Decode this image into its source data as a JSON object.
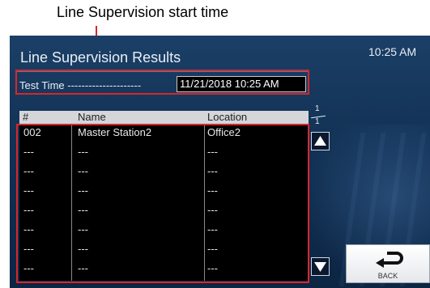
{
  "annotation": {
    "caption": "Line Supervision start time"
  },
  "header": {
    "title": "Line Supervision Results",
    "clock": "10:25 AM"
  },
  "test_time": {
    "label": "Test Time ---------------------",
    "value": "11/21/2018 10:25 AM"
  },
  "table": {
    "columns": [
      "#",
      "Name",
      "Location"
    ],
    "rows": [
      {
        "num": "002",
        "name": "Master Station2",
        "location": "Office2"
      },
      {
        "num": "---",
        "name": "---",
        "location": "---"
      },
      {
        "num": "---",
        "name": "---",
        "location": "---"
      },
      {
        "num": "---",
        "name": "---",
        "location": "---"
      },
      {
        "num": "---",
        "name": "---",
        "location": "---"
      },
      {
        "num": "---",
        "name": "---",
        "location": "---"
      },
      {
        "num": "---",
        "name": "---",
        "location": "---"
      },
      {
        "num": "---",
        "name": "---",
        "location": "---"
      }
    ]
  },
  "pagination": {
    "current": "1",
    "total": "1"
  },
  "buttons": {
    "back_label": "BACK"
  },
  "icons": {
    "scroll_up": "triangle-up-icon",
    "scroll_down": "triangle-down-icon",
    "back": "back-arrow-icon"
  },
  "colors": {
    "highlight": "#d8262a",
    "screen_bg": "#123154",
    "table_bg": "#000000"
  }
}
